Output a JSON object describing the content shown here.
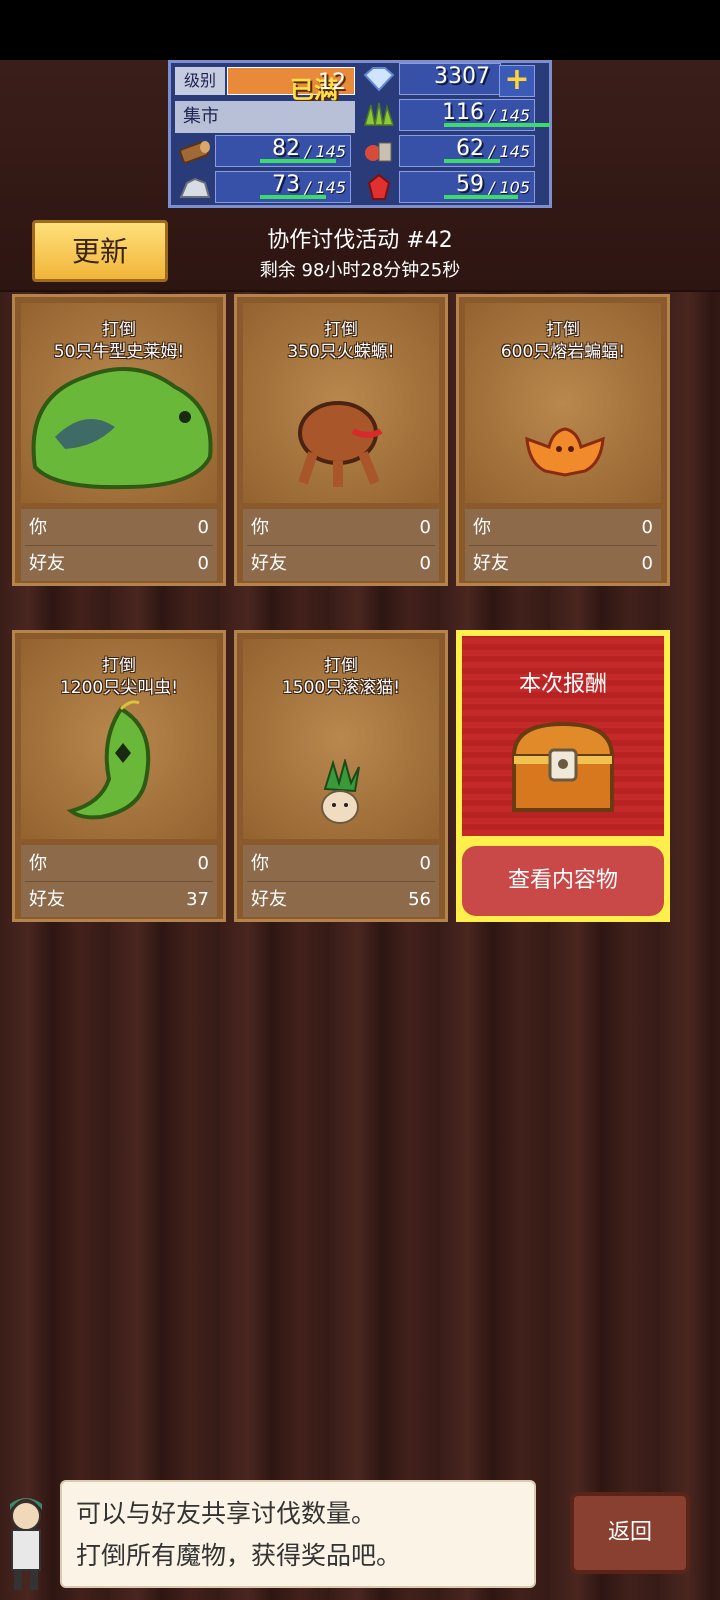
{
  "resources": {
    "level_label": "级别",
    "level_max": "已满",
    "level_value": "12",
    "gems": "3307",
    "market_label": "集市",
    "stats": [
      {
        "icon": "grass-icon",
        "value": "116",
        "max": "/ 145",
        "fill": 0.8
      },
      {
        "icon": "wood-log-icon",
        "value": "82",
        "max": "/ 145",
        "fill": 0.57
      },
      {
        "icon": "food-icon",
        "value": "62",
        "max": "/ 145",
        "fill": 0.43
      },
      {
        "icon": "ore-icon",
        "value": "73",
        "max": "/ 145",
        "fill": 0.5
      },
      {
        "icon": "red-crystal-icon",
        "value": "59",
        "max": "/ 105",
        "fill": 0.56
      }
    ]
  },
  "header": {
    "refresh_label": "更新",
    "event_title": "协作讨伐活动 #42",
    "timer": "剩余 98小时28分钟25秒"
  },
  "quests": [
    {
      "line1": "打倒",
      "line2": "50只牛型史莱姆!",
      "monster": "slime-monster-icon",
      "you_label": "你",
      "you": "0",
      "friend_label": "好友",
      "friend": "0"
    },
    {
      "line1": "打倒",
      "line2": "350只火蝾螈!",
      "monster": "fire-salamander-icon",
      "you_label": "你",
      "you": "0",
      "friend_label": "好友",
      "friend": "0"
    },
    {
      "line1": "打倒",
      "line2": "600只熔岩蝙蝠!",
      "monster": "lava-bat-icon",
      "you_label": "你",
      "you": "0",
      "friend_label": "好友",
      "friend": "0"
    },
    {
      "line1": "打倒",
      "line2": "1200只尖叫虫!",
      "monster": "screaming-worm-icon",
      "you_label": "你",
      "you": "0",
      "friend_label": "好友",
      "friend": "37"
    },
    {
      "line1": "打倒",
      "line2": "1500只滚滚猫!",
      "monster": "rolling-cat-icon",
      "you_label": "你",
      "you": "0",
      "friend_label": "好友",
      "friend": "56"
    }
  ],
  "reward": {
    "title": "本次报酬",
    "button": "查看内容物",
    "icon": "treasure-chest-icon"
  },
  "dialog": {
    "line1": "可以与好友共享讨伐数量。",
    "line2": "打倒所有魔物，获得奖品吧。"
  },
  "back_label": "返回"
}
